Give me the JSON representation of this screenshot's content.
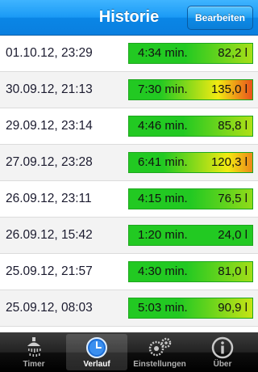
{
  "nav": {
    "title": "Historie",
    "edit_label": "Bearbeiten"
  },
  "rows": [
    {
      "date": "01.10.12, 23:29",
      "time": "4:34 min.",
      "volume": "82,2 l",
      "level": 0.55
    },
    {
      "date": "30.09.12, 21:13",
      "time": "7:30 min.",
      "volume": "135,0 l",
      "level": 1.0
    },
    {
      "date": "29.09.12, 23:14",
      "time": "4:46 min.",
      "volume": "85,8 l",
      "level": 0.57
    },
    {
      "date": "27.09.12, 23:28",
      "time": "6:41 min.",
      "volume": "120,3 l",
      "level": 0.9
    },
    {
      "date": "26.09.12, 23:11",
      "time": "4:15 min.",
      "volume": "76,5 l",
      "level": 0.5
    },
    {
      "date": "26.09.12, 15:42",
      "time": "1:20 min.",
      "volume": "24,0 l",
      "level": 0.12
    },
    {
      "date": "25.09.12, 21:57",
      "time": "4:30 min.",
      "volume": "81,0 l",
      "level": 0.54
    },
    {
      "date": "25.09.12, 08:03",
      "time": "5:03 min.",
      "volume": "90,9 l",
      "level": 0.62
    },
    {
      "date": "",
      "time": "",
      "volume": "",
      "level": 0.5
    }
  ],
  "tabs": [
    {
      "label": "Timer",
      "icon": "shower-icon"
    },
    {
      "label": "Verlauf",
      "icon": "clock-icon"
    },
    {
      "label": "Einstellungen",
      "icon": "gears-icon"
    },
    {
      "label": "Über",
      "icon": "info-icon"
    }
  ],
  "colors": {
    "bar_start": "#22c922",
    "bar_mid": "#f2ea12",
    "bar_end": "#e9521c"
  }
}
